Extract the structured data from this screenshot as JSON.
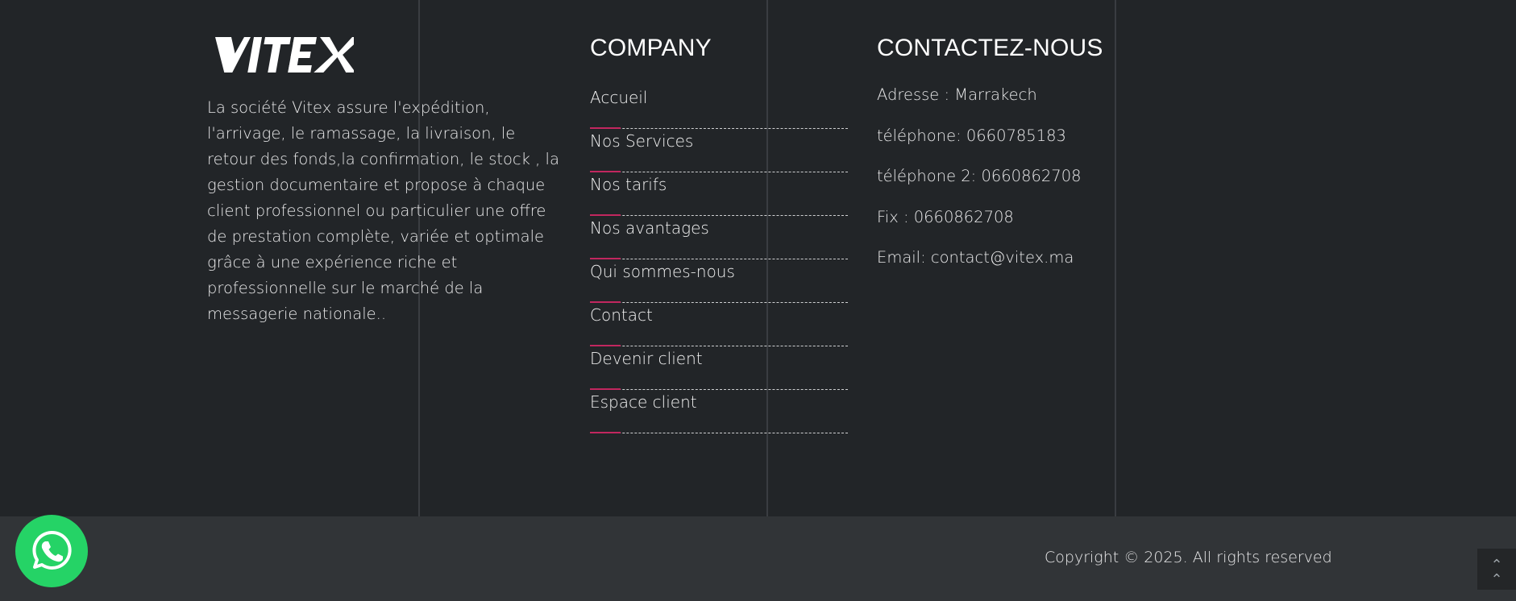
{
  "brand": {
    "logo_text": "VITEX"
  },
  "about": {
    "text": "La société Vitex assure l'expédition, l'arrivage, le ramassage, la livraison, le retour des fonds,la confirmation, le stock , la gestion documentaire et propose à chaque client professionnel ou particulier une offre de prestation complète, variée et optimale grâce à une expérience riche et professionnelle sur le marché de la messagerie nationale.."
  },
  "company": {
    "title": "COMPANY",
    "links": [
      {
        "label": "Accueil"
      },
      {
        "label": "Nos Services"
      },
      {
        "label": "Nos tarifs"
      },
      {
        "label": "Nos avantages"
      },
      {
        "label": "Qui sommes-nous"
      },
      {
        "label": "Contact"
      },
      {
        "label": "Devenir client"
      },
      {
        "label": "Espace client"
      }
    ]
  },
  "contact": {
    "title": "CONTACTEZ-NOUS",
    "items": [
      {
        "text": "Adresse : Marrakech"
      },
      {
        "text": "téléphone: 0660785183"
      },
      {
        "text": "téléphone 2: 0660862708"
      },
      {
        "text": "Fix : 0660862708"
      },
      {
        "text": "Email: contact@vitex.ma"
      }
    ]
  },
  "footer": {
    "copyright": "Copyright © 2025. All rights reserved"
  },
  "icons": {
    "whatsapp": "whatsapp-icon",
    "scroll_top": "double-chevron-up-icon"
  },
  "colors": {
    "background": "#222528",
    "bottom_bar": "#313437",
    "accent": "#c2275f",
    "whatsapp": "#25d366"
  }
}
